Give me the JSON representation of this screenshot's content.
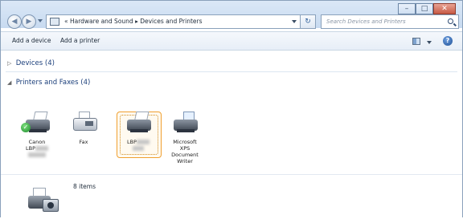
{
  "window": {
    "controls": {
      "minimize": "–",
      "maximize": "□",
      "close": "✕"
    }
  },
  "nav": {
    "back": "◀",
    "forward": "▶",
    "breadcrumb": "«  Hardware and Sound  ▸  Devices and Printers",
    "refresh": "↻",
    "search_placeholder": "Search Devices and Printers"
  },
  "toolbar": {
    "add_device": "Add a device",
    "add_printer": "Add a printer",
    "help": "?"
  },
  "groups": {
    "devices": {
      "arrow": "▷",
      "label": "Devices (4)"
    },
    "printers": {
      "arrow": "◢",
      "label": "Printers and Faxes (4)"
    }
  },
  "printers": [
    {
      "line1": "Canon",
      "line2": "LBP",
      "line3": ""
    },
    {
      "line1": "Fax"
    },
    {
      "line1": "LBP",
      "line2": ""
    },
    {
      "line1": "Microsoft",
      "line2": "XPS",
      "line3": "Document",
      "line4": "Writer"
    }
  ],
  "footer": {
    "count": "8 items"
  },
  "colors": {
    "selection_border": "#f0a030",
    "group_header": "#1a3e7a",
    "toolbar_bg": "#eef3f9"
  },
  "icons": [
    "search-icon",
    "printer-icon",
    "fax-icon",
    "xps-writer-icon",
    "camera-printer-icon",
    "help-icon",
    "view-icon",
    "check-icon"
  ]
}
